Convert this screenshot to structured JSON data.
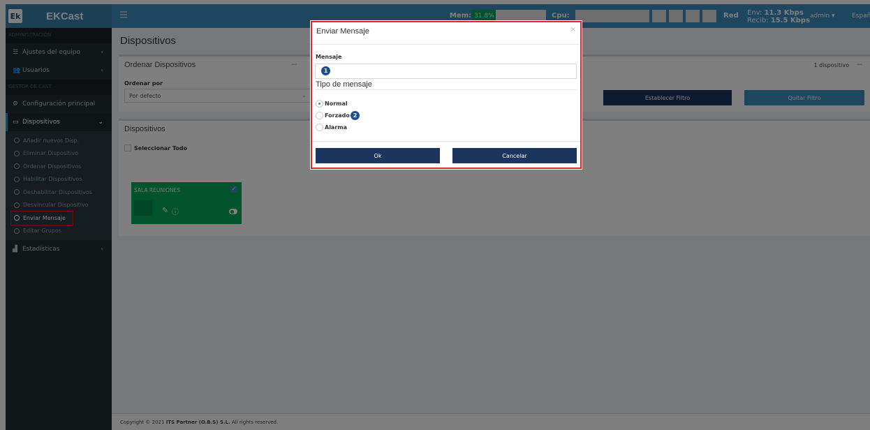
{
  "topbar": {
    "logo_text": "Ek",
    "app_title": "EKCast",
    "mem_label": "Mem:",
    "mem_value": "31.8%",
    "mem_percent": 31.8,
    "cpu_label": "Cpu:",
    "net_label": "Red",
    "net_env": "Env:",
    "net_env_value": "11.3 Kbps",
    "net_recib": "Recib:",
    "net_recib_value": "15.5 Kbps",
    "user": "admin ▾",
    "language": "Español"
  },
  "sidebar": {
    "header_admin": "ADMINISTRACIÓN",
    "item_settings": "Ajustes del equipo",
    "item_users": "Usuarios",
    "header_cast": "GESTOR DE CAST",
    "item_main_config": "Configuración principal",
    "item_devices": "Dispositivos",
    "sub_items": [
      "Añadir nuevos Disp.",
      "Eliminar Dispositivo",
      "Ordenar Dispositivos",
      "Habilitar Dispositivos",
      "Deshabilitar Dispositivos",
      "Desvincular Dispositivo",
      "Enviar Mensaje",
      "Editar Grupos"
    ],
    "item_stats": "Estadísticas"
  },
  "content": {
    "page_title": "Dispositivos",
    "order_box_title": "Ordenar Dispositivos",
    "order_by_label": "Ordenar por",
    "order_by_value": "Por defecto",
    "device_count": "1 dispositivo",
    "set_filter": "Establecer Filtro",
    "clear_filter": "Quitar Filtro",
    "devices_box_title": "Dispositivos",
    "select_all": "Seleccionar Todo",
    "device_name": "SALA REUNIONES",
    "footer_prefix": "Copyright © 2021 ",
    "footer_company": "ITS Partner (O.B.S) S.L.",
    "footer_suffix": " All rights reserved."
  },
  "modal": {
    "title": "Enviar Mensaje",
    "close": "×",
    "message_label": "Mensaje",
    "message_value": "",
    "type_label": "Tipo de mensaje",
    "options": [
      "Normal",
      "Forzado",
      "Alarma"
    ],
    "selected_option": "Normal",
    "ok": "Ok",
    "cancel": "Cancelar",
    "badge_1": "1",
    "badge_2": "2"
  },
  "colors": {
    "topbar": "#3c8dbc",
    "sidebar": "#222d32",
    "device_card": "#00a65a",
    "button_dark": "#1c355e",
    "highlight": "#d9272e"
  }
}
